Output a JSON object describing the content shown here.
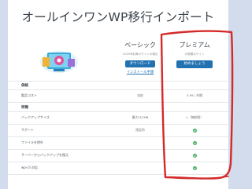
{
  "page": {
    "title": "オールインワンWP移行インポート"
  },
  "plans": {
    "basic": {
      "name": "ベーシック",
      "subtitle": "512MB未満のサイトの場合",
      "button": "ダウンロード",
      "link": "インストール手順"
    },
    "premium": {
      "name": "プレミアム",
      "subtitle": "大規模なサイト",
      "button": "始めましょう"
    }
  },
  "sections": {
    "price": "価格",
    "features": "特徴"
  },
  "rows": [
    {
      "label": "製品コスト",
      "basic": "自由",
      "premium": "$ 69 / 年間"
    },
    {
      "label": "バックアップサイズ",
      "basic": "最大512MB",
      "premium": "∞（無制限）"
    },
    {
      "label": "サポート",
      "basic": "限定的",
      "premium": ""
    },
    {
      "label": "ファイルを除外",
      "basic": "",
      "premium": ""
    },
    {
      "label": "サーバーからバックアップを復元",
      "basic": "",
      "premium": ""
    },
    {
      "label": "wp-cli 対応",
      "basic": "",
      "premium": ""
    }
  ],
  "colors": {
    "accent": "#2271b1",
    "check": "#3fae5e",
    "annotation": "#d42a2a",
    "page_bg": "#d2dcec"
  }
}
